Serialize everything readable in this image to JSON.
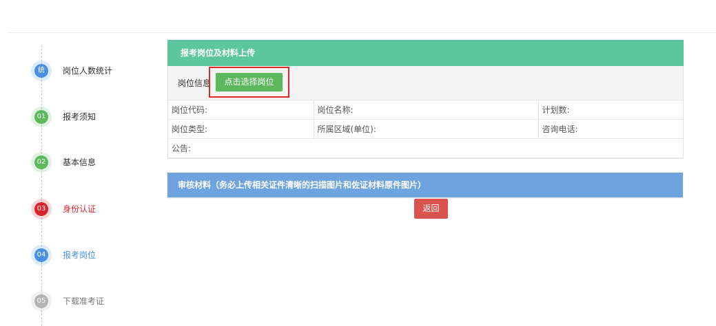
{
  "steps": [
    {
      "badge": "统",
      "label": "岗位人数统计",
      "color": "#4a90e2",
      "label_color": "#333333"
    },
    {
      "badge": "01",
      "label": "报考须知",
      "color": "#5cb85c",
      "label_color": "#333333"
    },
    {
      "badge": "02",
      "label": "基本信息",
      "color": "#5cb85c",
      "label_color": "#333333"
    },
    {
      "badge": "03",
      "label": "身份认证",
      "color": "#d9232d",
      "label_color": "#d9232d"
    },
    {
      "badge": "04",
      "label": "报考岗位",
      "color": "#4a90e2",
      "label_color": "#4a90e2"
    },
    {
      "badge": "05",
      "label": "下载准考证",
      "color": "#b3b3b3",
      "label_color": "#777777"
    }
  ],
  "panel": {
    "title": "报考岗位及材料上传",
    "post_info_label": "岗位信息",
    "choose_button": "点击选择岗位",
    "table": {
      "row1": {
        "code": "岗位代码:",
        "name": "岗位名称:",
        "plan": "计划数:"
      },
      "row2": {
        "type": "岗位类型:",
        "region": "所属区域(单位):",
        "phone": "咨询电话:"
      },
      "row3": {
        "notice": "公告:"
      }
    }
  },
  "review": {
    "title": "审核材料（务必上传相关证件清晰的扫描图片和佐证材料原件图片）"
  },
  "actions": {
    "back": "返回"
  },
  "colors": {
    "panel_header": "#5cc69d",
    "choose_button": "#5cb85c",
    "highlight": "#e02727",
    "review_bar": "#6fa3de",
    "back_button": "#d9534f"
  }
}
